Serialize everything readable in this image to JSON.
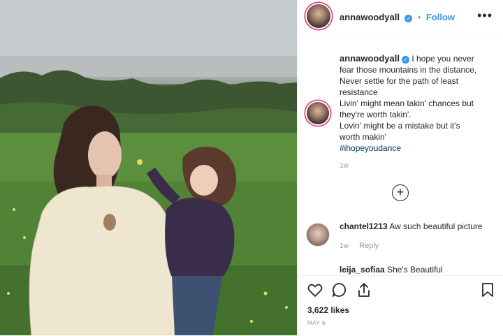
{
  "post": {
    "username": "annawoodyall",
    "verified_mark": "✓",
    "dot": "•",
    "follow_label": "Follow",
    "more_label": "•••",
    "caption_lines": [
      "I hope you never",
      "fear those mountains in the distance,",
      "Never settle for the path of least",
      "resistance",
      "Livin' might mean takin' chances but",
      "they're worth takin'.",
      "Lovin' might be a mistake but it's",
      "worth makin'"
    ],
    "hashtag": "#ihopeyoudance",
    "time": "1w",
    "load_more_icon": "plus-circle-icon",
    "likes": "3,622 likes",
    "date": "MAY 6"
  },
  "comments": [
    {
      "user": "chantel1213",
      "text": "Aw such beautiful picture",
      "time": "1w",
      "reply": "Reply"
    },
    {
      "user": "leija_sofiaa",
      "text": "She's Beautiful"
    }
  ],
  "actions": {
    "icons": [
      "heart-icon",
      "comment-icon",
      "share-icon",
      "bookmark-icon"
    ]
  },
  "colors": {
    "accent": "#3897f0",
    "text": "#262626",
    "muted": "#999999",
    "hashtag": "#003569",
    "story_ring": "#e1306c"
  }
}
